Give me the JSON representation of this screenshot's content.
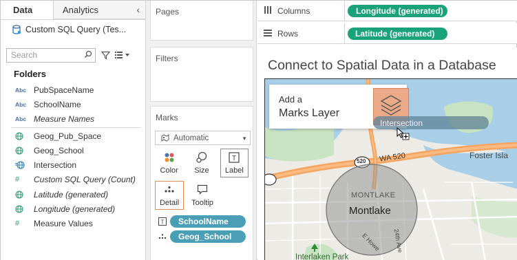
{
  "data_pane": {
    "tabs": [
      {
        "label": "Data",
        "active": true
      },
      {
        "label": "Analytics",
        "active": false
      }
    ],
    "collapse_icon": "chevron-left",
    "data_source": "Custom SQL Query (Tes...",
    "search_placeholder": "Search",
    "folders_label": "Folders",
    "fields": [
      {
        "type": "Abc",
        "name": "PubSpaceName",
        "italic": false
      },
      {
        "type": "Abc",
        "name": "SchoolName",
        "italic": false
      },
      {
        "type": "Abc",
        "name": "Measure Names",
        "italic": true
      },
      {
        "type": "geo",
        "name": "Geog_Pub_Space",
        "italic": false
      },
      {
        "type": "geo",
        "name": "Geog_School",
        "italic": false
      },
      {
        "type": "geo-calc",
        "name": "Intersection",
        "italic": false
      },
      {
        "type": "#",
        "name": "Custom SQL Query (Count)",
        "italic": true
      },
      {
        "type": "geo",
        "name": "Latitude (generated)",
        "italic": true
      },
      {
        "type": "geo",
        "name": "Longitude (generated)",
        "italic": true
      },
      {
        "type": "#",
        "name": "Measure Values",
        "italic": false
      }
    ]
  },
  "cards": {
    "pages": "Pages",
    "filters": "Filters",
    "marks": "Marks",
    "mark_type": "Automatic",
    "mark_buttons": [
      "Color",
      "Size",
      "Label",
      "Detail",
      "Tooltip"
    ],
    "mark_pills": [
      {
        "icon": "T",
        "label": "SchoolName"
      },
      {
        "icon": "detail",
        "label": "Geog_School"
      }
    ]
  },
  "shelves": {
    "columns_label": "Columns",
    "columns_pill": "Longitude (generated)",
    "rows_label": "Rows",
    "rows_pill": "Latitude (generated)"
  },
  "viz": {
    "title": "Connect to Spatial Data in a Database",
    "add_layer_line1": "Add a",
    "add_layer_line2": "Marks Layer",
    "drag_pill": "Intersection",
    "map_labels": {
      "highway": "WA 520",
      "shield": "520",
      "montlake_caps": "MONTLAKE",
      "montlake": "Montlake",
      "foster": "Foster Isla",
      "interlaken": "Interlaken Park",
      "street1": "E Howe",
      "street2": "24th Ave"
    }
  },
  "colors": {
    "geo_pill": "#1aa37a",
    "mark_pill": "#4a9fb7",
    "layer_drop": "#eca987",
    "water": "#a9cfe8",
    "land": "#ecebe5"
  }
}
